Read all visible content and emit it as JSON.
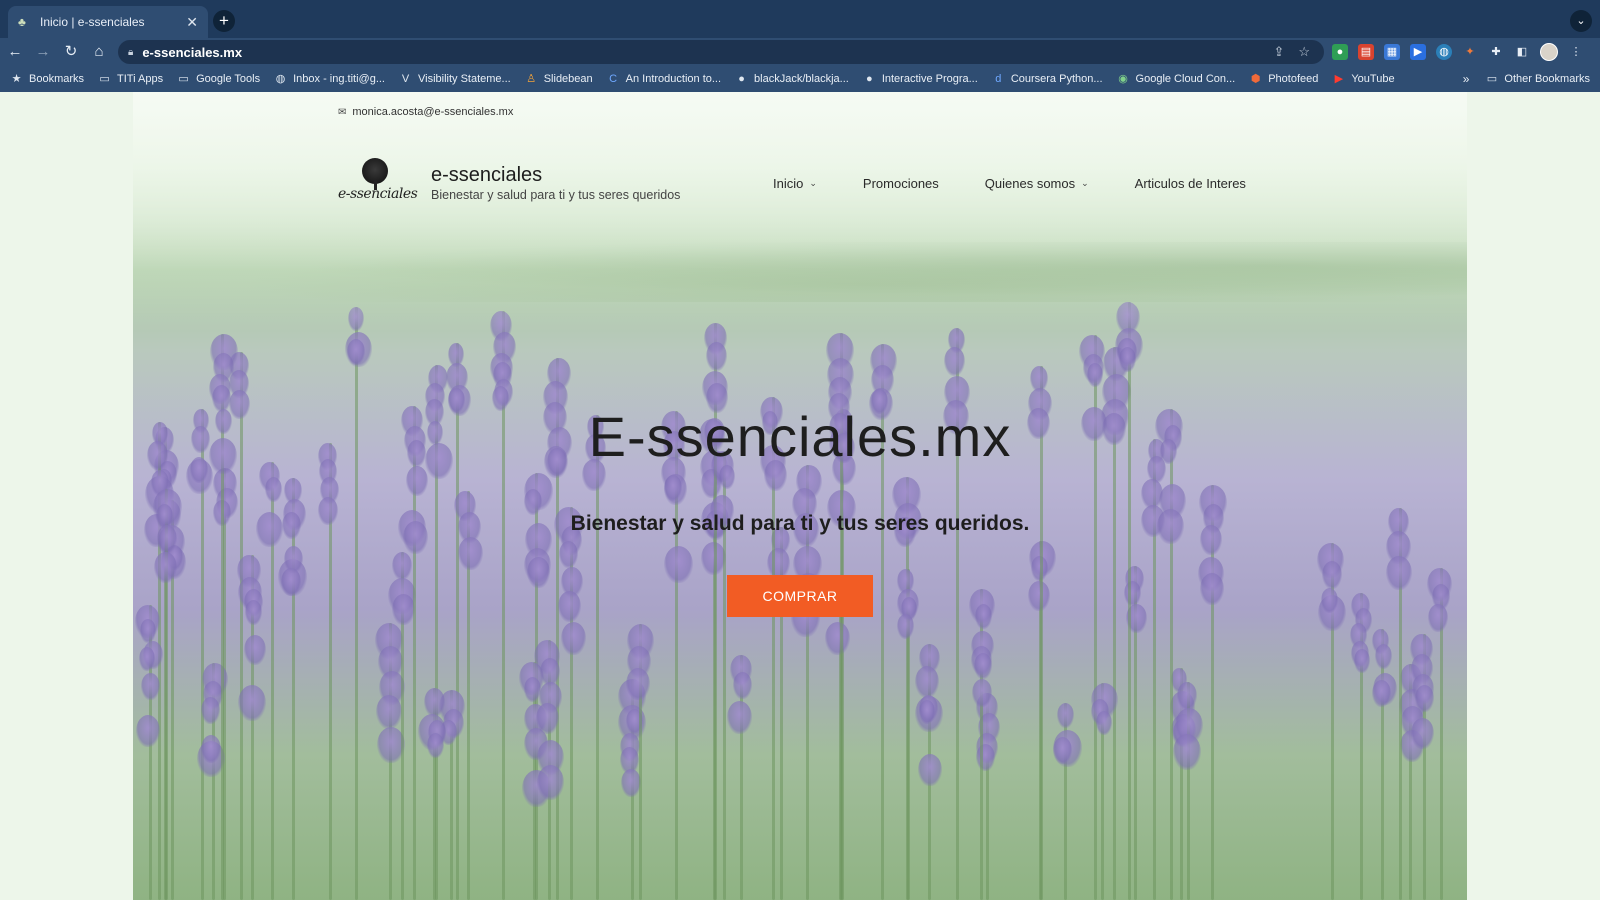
{
  "browser": {
    "tab_title": "Inicio | e-ssenciales",
    "tab_close": "✕",
    "new_tab": "+",
    "tab_menu": "⌄",
    "url": "e-ssenciales.mx",
    "nav": {
      "back": "←",
      "forward": "→",
      "reload": "↻",
      "home": "⌂"
    },
    "bookmarks": [
      {
        "label": "Bookmarks",
        "icon": "star-icon",
        "glyph": "★"
      },
      {
        "label": "TITi Apps",
        "icon": "folder-icon",
        "glyph": "▭"
      },
      {
        "label": "Google Tools",
        "icon": "folder-icon",
        "glyph": "▭"
      },
      {
        "label": "Inbox - ing.titi@g...",
        "icon": "globe-icon",
        "glyph": "◍"
      },
      {
        "label": "Visibility Stateme...",
        "icon": "v-icon",
        "glyph": "V"
      },
      {
        "label": "Slidebean",
        "icon": "slidebean-icon",
        "glyph": "♙"
      },
      {
        "label": "An Introduction to...",
        "icon": "c-icon",
        "glyph": "C"
      },
      {
        "label": "blackJack/blackja...",
        "icon": "github-icon",
        "glyph": "●"
      },
      {
        "label": "Interactive Progra...",
        "icon": "github-icon",
        "glyph": "●"
      },
      {
        "label": "Coursera Python...",
        "icon": "d-icon",
        "glyph": "d"
      },
      {
        "label": "Google Cloud Con...",
        "icon": "google-cloud-icon",
        "glyph": "◉"
      },
      {
        "label": "Photofeed",
        "icon": "photofeed-icon",
        "glyph": "⬢"
      },
      {
        "label": "YouTube",
        "icon": "youtube-icon",
        "glyph": "▶"
      }
    ],
    "more_bookmarks": "»",
    "other_bookmarks": "Other Bookmarks"
  },
  "site": {
    "contact_email": "monica.acosta@e-ssenciales.mx",
    "brand_name": "e-ssenciales",
    "logo_script": "e-ssenciales",
    "brand_tagline": "Bienestar y salud para ti y tus seres queridos",
    "nav": [
      {
        "label": "Inicio",
        "dropdown": true
      },
      {
        "label": "Promociones",
        "dropdown": false
      },
      {
        "label": "Quienes somos",
        "dropdown": true
      },
      {
        "label": "Articulos de Interes",
        "dropdown": false
      }
    ],
    "hero_title": "E-ssenciales.mx",
    "hero_subtitle": "Bienestar y salud para ti y tus seres queridos.",
    "cta_label": "COMPRAR",
    "colors": {
      "cta": "#f25c24",
      "chrome": "#2f4d72"
    }
  }
}
